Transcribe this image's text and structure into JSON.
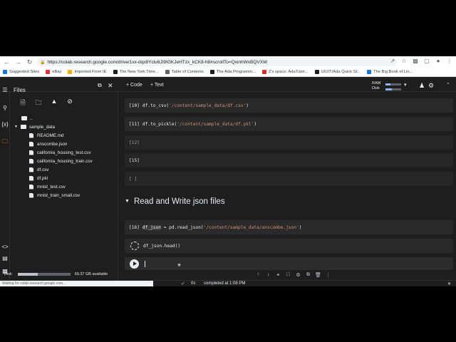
{
  "browser": {
    "url": "https://colab.research.google.com/drive/1xx-dqx8Yclu6JI9IGKJeHTzx_kCK8-h8#scrollTo=QxinhWxBQVXW",
    "bookmarks": [
      {
        "label": "Suggested Sites",
        "color": "#1a73e8"
      },
      {
        "label": "eBay",
        "color": "#e53238"
      },
      {
        "label": "Imported From IE",
        "color": "#f9ab00"
      },
      {
        "label": "The New York Time...",
        "color": "#202124"
      },
      {
        "label": "Table of Contents",
        "color": "#5f6368"
      },
      {
        "label": "The Ada Programm...",
        "color": "#202124"
      },
      {
        "label": "Z's space: AdaTutor...",
        "color": "#d93025"
      },
      {
        "label": "UIUIT/Ada Quick St...",
        "color": "#202124"
      },
      {
        "label": "The Big Book of Lin...",
        "color": "#1a73e8"
      }
    ]
  },
  "toolbar": {
    "add_code": "+ Code",
    "add_text": "+ Text",
    "ram_label": "RAM",
    "disk_label": "Disk"
  },
  "files_panel": {
    "title": "Files",
    "parent": "..",
    "folder": "sample_data",
    "files": [
      "README.md",
      "anscombe.json",
      "california_housing_test.csv",
      "california_housing_train.csv",
      "df.csv",
      "df.pkl",
      "mnist_test.csv",
      "mnist_train_small.csv"
    ],
    "disk_label": "Disk",
    "disk_available": "69.37 GB available",
    "disk_used_fraction": 0.38
  },
  "cells": [
    {
      "num": "[10]",
      "code_pre": "df.to_csv(",
      "code_str": "'/content/sample_data/df.csv'",
      "code_post": ")"
    },
    {
      "num": "[11]",
      "code_pre": "df.to_pickle(",
      "code_str": "'/content/sample_data/df.pkl'",
      "code_post": ")"
    },
    {
      "num": "[12]",
      "code_pre": "",
      "code_str": "",
      "code_post": ""
    },
    {
      "num": "[15]",
      "code_pre": "",
      "code_str": "",
      "code_post": ""
    },
    {
      "num": "[ ]",
      "code_pre": "",
      "code_str": "",
      "code_post": ""
    }
  ],
  "section_heading": "Read and Write json files",
  "json_cell": {
    "num": "[16]",
    "var": "df_json",
    "code_pre": " = pd.read_json(",
    "code_str": "'/content/sample_data/anscombe.json'",
    "code_post": ")"
  },
  "running_cell": {
    "code": "df_json.head()"
  },
  "status": {
    "left_text": "Waiting for colab.research.google.com...",
    "elapsed": "0s",
    "completed": "completed at 1:08 PM"
  }
}
